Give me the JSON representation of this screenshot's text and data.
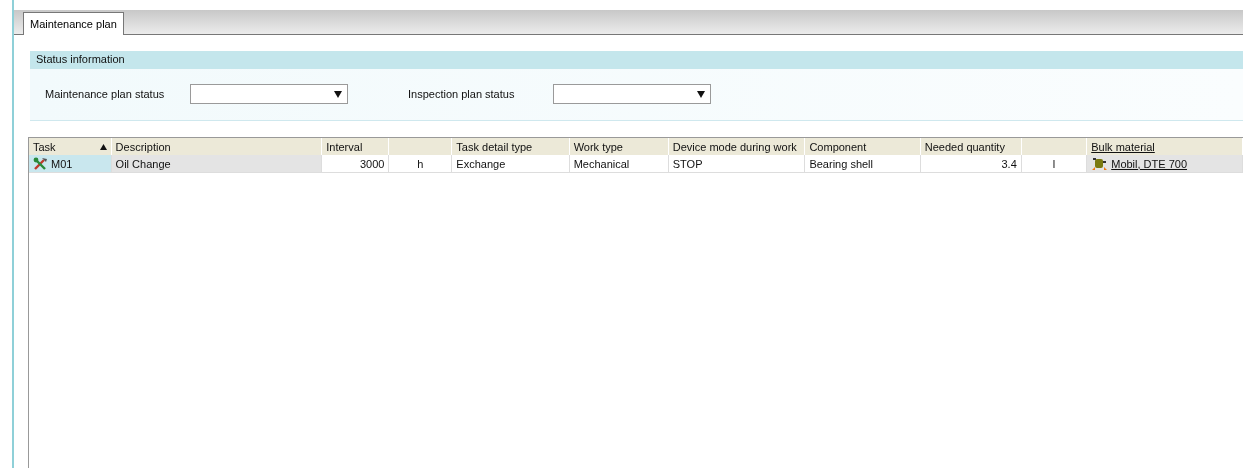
{
  "tabs": [
    {
      "label": "Maintenance plan",
      "selected": true
    }
  ],
  "status_panel": {
    "title": "Status information",
    "fields": [
      {
        "label": "Maintenance plan status"
      },
      {
        "label": "Inspection plan status"
      }
    ]
  },
  "table": {
    "columns": [
      {
        "label": "Task",
        "sorted": true,
        "link": false
      },
      {
        "label": "Description",
        "sorted": false,
        "link": false
      },
      {
        "label": "Interval",
        "sorted": false,
        "link": false
      },
      {
        "sorted": false
      },
      {
        "label": "Task detail type",
        "sorted": false,
        "link": false
      },
      {
        "label": "Work type",
        "sorted": false,
        "link": false
      },
      {
        "label": "Device mode during work",
        "sorted": false,
        "link": false
      },
      {
        "label": "Component",
        "sorted": false,
        "link": false
      },
      {
        "label": "Needed quantity",
        "sorted": false,
        "link": false
      },
      {
        "sorted": false
      },
      {
        "label": "Bulk material",
        "sorted": false,
        "link": true
      }
    ],
    "rows": [
      {
        "cells": [
          {
            "text": "M01",
            "kind": "task"
          },
          {
            "text": "Oil Change",
            "kind": "grey"
          },
          {
            "text": "3000",
            "kind": "number"
          },
          {
            "text": "h",
            "kind": "unit"
          },
          {
            "text": "Exchange",
            "kind": "text"
          },
          {
            "text": "Mechanical",
            "kind": "text"
          },
          {
            "text": "STOP",
            "kind": "text"
          },
          {
            "text": "Bearing shell",
            "kind": "text"
          },
          {
            "text": "3.4",
            "kind": "number"
          },
          {
            "text": "l",
            "kind": "unit"
          },
          {
            "text": "Mobil, DTE 700",
            "kind": "material"
          }
        ]
      }
    ]
  }
}
